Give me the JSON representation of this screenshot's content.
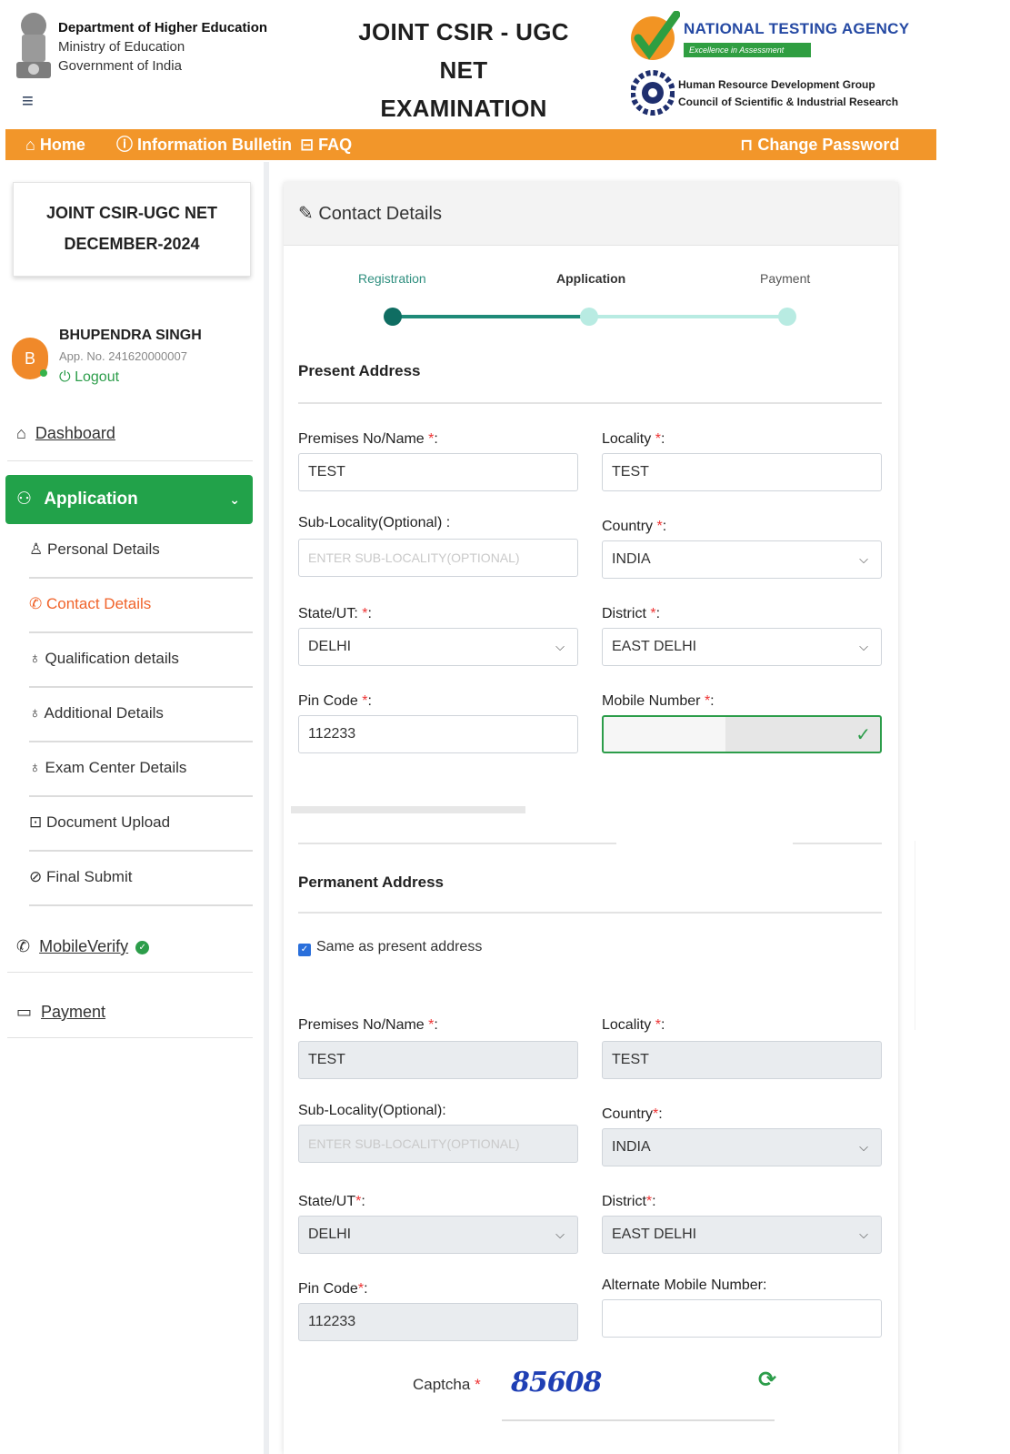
{
  "header": {
    "dept_title": "Department of Higher Education",
    "dept_line2": "Ministry of Education",
    "dept_line3": "Government of India",
    "exam_title_line1": "JOINT CSIR - UGC NET",
    "exam_title_line2": "EXAMINATION",
    "nta_name": "NATIONAL TESTING AGENCY",
    "nta_tagline": "Excellence in Assessment",
    "hrdg_line1": "Human Resource Development Group",
    "hrdg_line2": "Council of Scientific & Industrial Research"
  },
  "navbar": {
    "home": "Home",
    "info_bulletin": "Information Bulletin",
    "faq": "FAQ",
    "change_password": "Change Password",
    "bg_color": "#f2962a"
  },
  "sidebar": {
    "exam_card_line1": "JOINT CSIR-UGC NET",
    "exam_card_line2": "DECEMBER-2024",
    "user": {
      "initial": "B",
      "name": "BHUPENDRA SINGH",
      "app_no": "App. No. 241620000007",
      "logout": "Logout"
    },
    "dashboard": "Dashboard",
    "application": "Application",
    "sub_items": [
      {
        "label": "Personal Details",
        "icon": "person-icon"
      },
      {
        "label": "Contact Details",
        "icon": "phone-icon",
        "active": true
      },
      {
        "label": "Qualification details",
        "icon": "bulb-icon"
      },
      {
        "label": "Additional Details",
        "icon": "bulb-icon"
      },
      {
        "label": "Exam Center Details",
        "icon": "bulb-icon"
      },
      {
        "label": "Document Upload",
        "icon": "upload-icon"
      },
      {
        "label": "Final Submit",
        "icon": "check-circle-icon"
      }
    ],
    "mobile_verify": "MobileVerify",
    "payment": "Payment",
    "accent_color": "#22a24a"
  },
  "card": {
    "title": "Contact Details",
    "steps": [
      "Registration",
      "Application",
      "Payment"
    ],
    "present_address": {
      "heading": "Present Address",
      "premises_label": "Premises No/Name",
      "premises_value": "TEST",
      "locality_label": "Locality",
      "locality_value": "TEST",
      "sublocality_label": "Sub-Locality(Optional) :",
      "sublocality_placeholder": "ENTER SUB-LOCALITY(OPTIONAL)",
      "country_label": "Country",
      "country_value": "INDIA",
      "state_label": "State/UT:",
      "state_value": "DELHI",
      "district_label": "District",
      "district_value": "EAST DELHI",
      "pin_label": "Pin Code",
      "pin_value": "112233",
      "mobile_label": "Mobile Number"
    },
    "permanent_address": {
      "heading": "Permanent Address",
      "same_as_present": "Same as present address",
      "premises_label": "Premises No/Name",
      "premises_value": "TEST",
      "locality_label": "Locality",
      "locality_value": "TEST",
      "sublocality_label": "Sub-Locality(Optional):",
      "sublocality_placeholder": "ENTER SUB-LOCALITY(OPTIONAL)",
      "country_label": "Country",
      "country_value": "INDIA",
      "state_label": "State/UT",
      "state_value": "DELHI",
      "district_label": "District",
      "district_value": "EAST DELHI",
      "pin_label": "Pin Code",
      "pin_value": "112233",
      "alt_mobile_label": "Alternate Mobile Number:"
    },
    "captcha_label": "Captcha",
    "captcha_value": "85608"
  }
}
